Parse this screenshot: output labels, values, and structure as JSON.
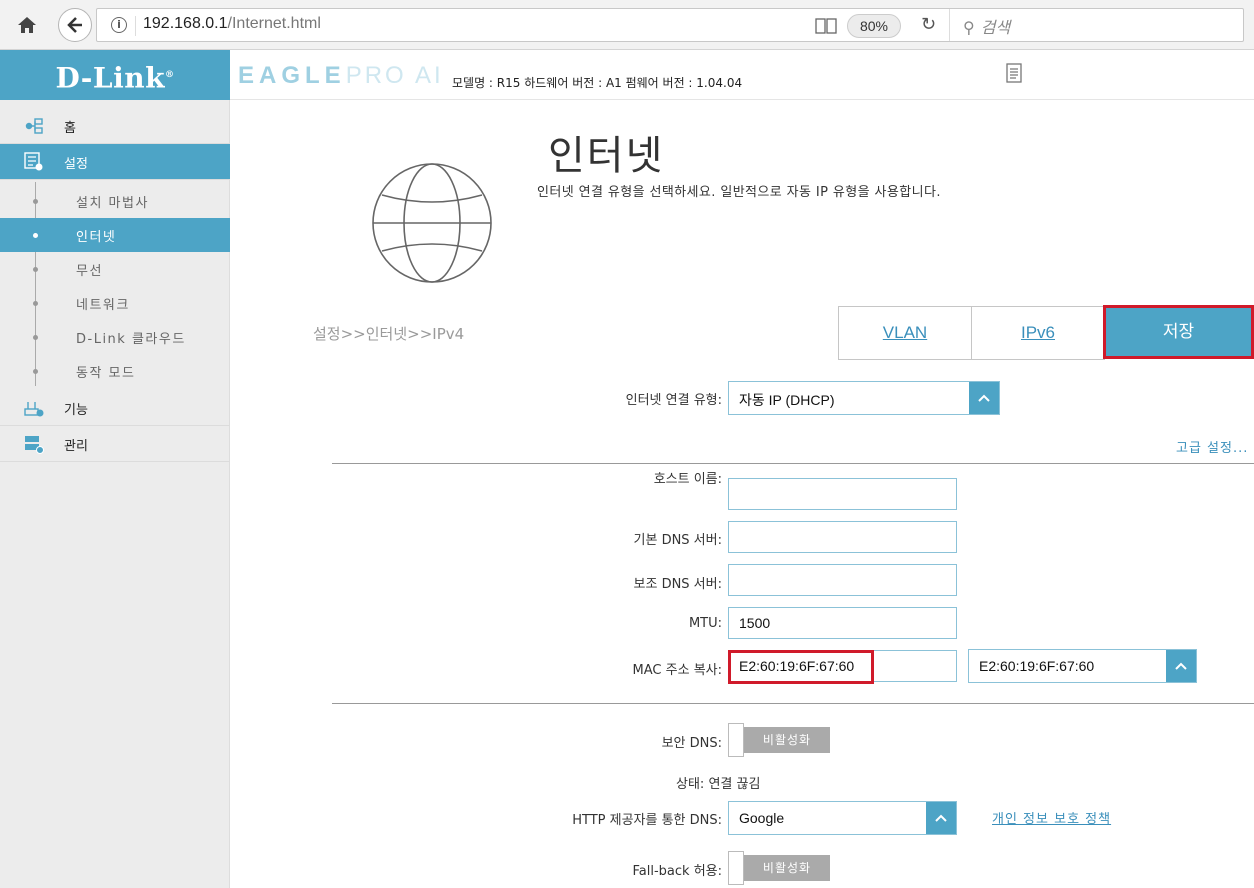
{
  "browser": {
    "url_host": "192.168.0.1",
    "url_path": "/Internet.html",
    "zoom": "80%",
    "search_placeholder": "검색"
  },
  "header": {
    "logo": "D-Link",
    "brand_main": "EAGLE",
    "brand_sub": "PRO AI",
    "model_info": "모델명 : R15 하드웨어 버전 : A1 펌웨어 버전 : 1.04.04"
  },
  "sidebar": {
    "home": "홈",
    "settings": "설정",
    "sub_items": [
      "설치 마법사",
      "인터넷",
      "무선",
      "네트워크",
      "D-Link 클라우드",
      "동작 모드"
    ],
    "features": "기능",
    "management": "관리"
  },
  "page": {
    "title": "인터넷",
    "description": "인터넷 연결 유형을 선택하세요. 일반적으로 자동 IP 유형을 사용합니다.",
    "breadcrumb": "설정>>인터넷>>IPv4",
    "tab_vlan": "VLAN",
    "tab_ipv6": "IPv6",
    "save": "저장"
  },
  "form": {
    "conn_type_label": "인터넷 연결 유형:",
    "conn_type_value": "자동 IP (DHCP)",
    "advanced_link": "고급 설정...",
    "host_label": "호스트 이름:",
    "host_value": "",
    "dns1_label": "기본 DNS 서버:",
    "dns1_value": "",
    "dns2_label": "보조 DNS 서버:",
    "dns2_value": "",
    "mtu_label": "MTU:",
    "mtu_value": "1500",
    "mac_label": "MAC 주소 복사:",
    "mac_value": "E2:60:19:6F:67:60",
    "mac_select_value": "E2:60:19:6F:67:60",
    "secure_dns_label": "보안 DNS:",
    "secure_dns_state": "비활성화",
    "status_label": "상태:",
    "status_value": "연결 끊김",
    "https_dns_label": "HTTP 제공자를 통한 DNS:",
    "https_dns_value": "Google",
    "privacy_link": "개인 정보 보호 정책",
    "fallback_label": "Fall-back 허용:",
    "fallback_state": "비활성화"
  },
  "colors": {
    "accent": "#4da4c6",
    "highlight": "#d01a2a",
    "link": "#3a8fbb"
  }
}
